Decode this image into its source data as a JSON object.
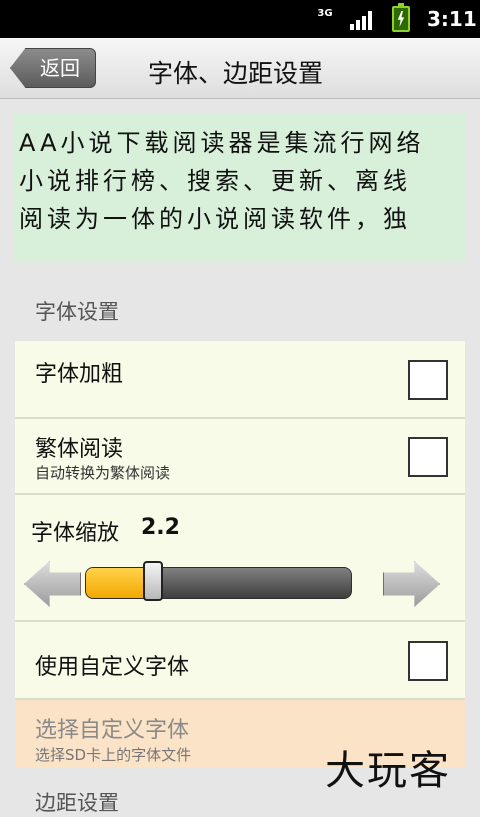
{
  "status_bar": {
    "network": "3G",
    "time": "3:11"
  },
  "header": {
    "back_label": "返回",
    "title": "字体、边距设置"
  },
  "intro_text": {
    "lines": [
      "AA小说下载阅读器是集流行网络",
      "小说排行榜、搜索、更新、离线",
      "阅读为一体的小说阅读软件，独"
    ]
  },
  "font_settings": {
    "section_title": "字体设置",
    "bold": {
      "label": "字体加粗",
      "checked": false
    },
    "traditional": {
      "label": "繁体阅读",
      "subtitle": "自动转换为繁体阅读",
      "checked": false
    },
    "scale": {
      "label": "字体缩放",
      "value": "2.2",
      "fraction": 0.25
    },
    "custom_font": {
      "label": "使用自定义字体",
      "checked": false
    },
    "choose_font": {
      "label": "选择自定义字体",
      "subtitle": "选择SD卡上的字体文件"
    }
  },
  "next_section_title": "边距设置",
  "watermark": "大玩客",
  "colors": {
    "intro_background": "#d8f0da",
    "panel_background": "#f7fbe8",
    "highlight_background": "#fbe3c8",
    "slider_fill": "#f3a800"
  }
}
